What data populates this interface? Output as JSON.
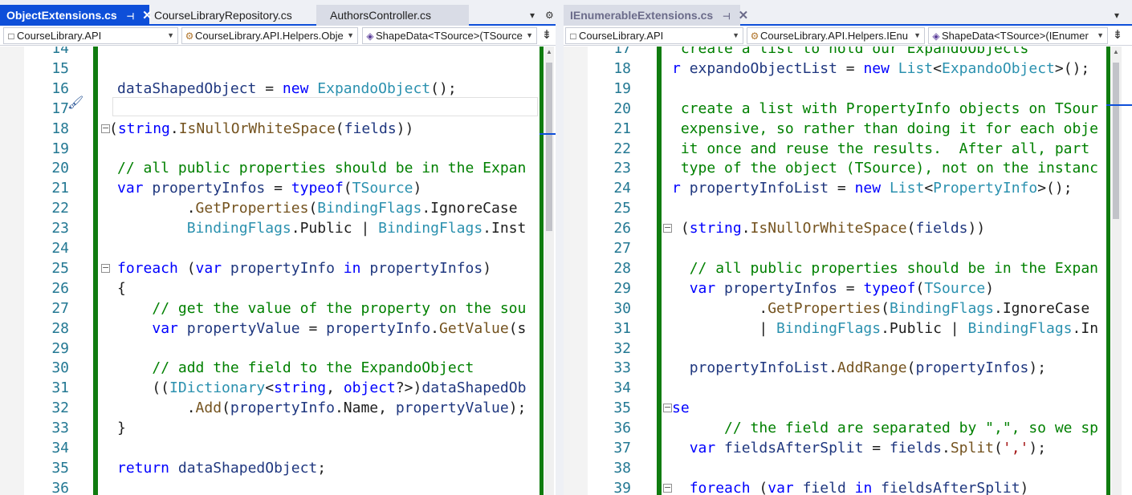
{
  "left_pane": {
    "tabs": [
      {
        "label": "ObjectExtensions.cs",
        "pin_icon": "pin-icon",
        "close_icon": "close-icon"
      },
      {
        "label": "CourseLibraryRepository.cs"
      },
      {
        "label": "AuthorsController.cs"
      }
    ],
    "tab_tools": {
      "dropdown": "▾",
      "settings": "⚙"
    },
    "nav": {
      "project": "CourseLibrary.API",
      "type": "CourseLibrary.API.Helpers.Obje",
      "member": "ShapeData<TSource>(TSource"
    },
    "lines": [
      {
        "n": "14",
        "fold": false,
        "segs": [
          {
            "c": "",
            "t": ""
          }
        ]
      },
      {
        "n": "15",
        "fold": false,
        "segs": [
          {
            "c": "",
            "t": ""
          }
        ]
      },
      {
        "n": "16",
        "fold": false,
        "segs": [
          {
            "c": "id",
            "t": "dataShapedObject"
          },
          {
            "c": "",
            "t": " = "
          },
          {
            "c": "kw",
            "t": "new"
          },
          {
            "c": "",
            "t": " "
          },
          {
            "c": "ty",
            "t": "ExpandoObject"
          },
          {
            "c": "",
            "t": "();"
          }
        ]
      },
      {
        "n": "17",
        "fold": false,
        "segs": [
          {
            "c": "",
            "t": ""
          }
        ]
      },
      {
        "n": "18",
        "fold": true,
        "segs": [
          {
            "c": "",
            "t": "("
          },
          {
            "c": "kw",
            "t": "string"
          },
          {
            "c": "",
            "t": "."
          },
          {
            "c": "mt",
            "t": "IsNullOrWhiteSpace"
          },
          {
            "c": "",
            "t": "("
          },
          {
            "c": "id",
            "t": "fields"
          },
          {
            "c": "",
            "t": "))"
          }
        ]
      },
      {
        "n": "19",
        "fold": false,
        "segs": [
          {
            "c": "",
            "t": ""
          }
        ]
      },
      {
        "n": "20",
        "fold": false,
        "segs": [
          {
            "c": "cm",
            "t": "// all public properties should be in the Expan"
          }
        ]
      },
      {
        "n": "21",
        "fold": false,
        "segs": [
          {
            "c": "kw",
            "t": "var"
          },
          {
            "c": "",
            "t": " "
          },
          {
            "c": "id",
            "t": "propertyInfos"
          },
          {
            "c": "",
            "t": " = "
          },
          {
            "c": "kw",
            "t": "typeof"
          },
          {
            "c": "",
            "t": "("
          },
          {
            "c": "ty",
            "t": "TSource"
          },
          {
            "c": "",
            "t": ")"
          }
        ]
      },
      {
        "n": "22",
        "fold": false,
        "segs": [
          {
            "c": "",
            "t": "        ."
          },
          {
            "c": "mt",
            "t": "GetProperties"
          },
          {
            "c": "",
            "t": "("
          },
          {
            "c": "ty",
            "t": "BindingFlags"
          },
          {
            "c": "",
            "t": ".IgnoreCase"
          }
        ]
      },
      {
        "n": "23",
        "fold": false,
        "segs": [
          {
            "c": "",
            "t": "        "
          },
          {
            "c": "ty",
            "t": "BindingFlags"
          },
          {
            "c": "",
            "t": ".Public | "
          },
          {
            "c": "ty",
            "t": "BindingFlags"
          },
          {
            "c": "",
            "t": ".Inst"
          }
        ]
      },
      {
        "n": "24",
        "fold": false,
        "segs": [
          {
            "c": "",
            "t": ""
          }
        ]
      },
      {
        "n": "25",
        "fold": true,
        "segs": [
          {
            "c": "kw",
            "t": "foreach"
          },
          {
            "c": "",
            "t": " ("
          },
          {
            "c": "kw",
            "t": "var"
          },
          {
            "c": "",
            "t": " "
          },
          {
            "c": "id",
            "t": "propertyInfo"
          },
          {
            "c": "",
            "t": " "
          },
          {
            "c": "kw",
            "t": "in"
          },
          {
            "c": "",
            "t": " "
          },
          {
            "c": "id",
            "t": "propertyInfos"
          },
          {
            "c": "",
            "t": ")"
          }
        ]
      },
      {
        "n": "26",
        "fold": false,
        "segs": [
          {
            "c": "",
            "t": "{"
          }
        ]
      },
      {
        "n": "27",
        "fold": false,
        "segs": [
          {
            "c": "",
            "t": "    "
          },
          {
            "c": "cm",
            "t": "// get the value of the property on the sou"
          }
        ]
      },
      {
        "n": "28",
        "fold": false,
        "segs": [
          {
            "c": "",
            "t": "    "
          },
          {
            "c": "kw",
            "t": "var"
          },
          {
            "c": "",
            "t": " "
          },
          {
            "c": "id",
            "t": "propertyValue"
          },
          {
            "c": "",
            "t": " = "
          },
          {
            "c": "id",
            "t": "propertyInfo"
          },
          {
            "c": "",
            "t": "."
          },
          {
            "c": "mt",
            "t": "GetValue"
          },
          {
            "c": "",
            "t": "(s"
          }
        ]
      },
      {
        "n": "29",
        "fold": false,
        "segs": [
          {
            "c": "",
            "t": ""
          }
        ]
      },
      {
        "n": "30",
        "fold": false,
        "segs": [
          {
            "c": "",
            "t": "    "
          },
          {
            "c": "cm",
            "t": "// add the field to the ExpandoObject"
          }
        ]
      },
      {
        "n": "31",
        "fold": false,
        "segs": [
          {
            "c": "",
            "t": "    (("
          },
          {
            "c": "ty",
            "t": "IDictionary"
          },
          {
            "c": "",
            "t": "<"
          },
          {
            "c": "kw",
            "t": "string"
          },
          {
            "c": "",
            "t": ", "
          },
          {
            "c": "kw",
            "t": "object"
          },
          {
            "c": "",
            "t": "?>)"
          },
          {
            "c": "id",
            "t": "dataShapedOb"
          }
        ]
      },
      {
        "n": "32",
        "fold": false,
        "segs": [
          {
            "c": "",
            "t": "        ."
          },
          {
            "c": "mt",
            "t": "Add"
          },
          {
            "c": "",
            "t": "("
          },
          {
            "c": "id",
            "t": "propertyInfo"
          },
          {
            "c": "",
            "t": ".Name, "
          },
          {
            "c": "id",
            "t": "propertyValue"
          },
          {
            "c": "",
            "t": ");"
          }
        ]
      },
      {
        "n": "33",
        "fold": false,
        "segs": [
          {
            "c": "",
            "t": "}"
          }
        ]
      },
      {
        "n": "34",
        "fold": false,
        "segs": [
          {
            "c": "",
            "t": ""
          }
        ]
      },
      {
        "n": "35",
        "fold": false,
        "segs": [
          {
            "c": "kw",
            "t": "return"
          },
          {
            "c": "",
            "t": " "
          },
          {
            "c": "id",
            "t": "dataShapedObject"
          },
          {
            "c": "",
            "t": ";"
          }
        ]
      },
      {
        "n": "36",
        "fold": false,
        "segs": [
          {
            "c": "",
            "t": ""
          }
        ]
      }
    ]
  },
  "right_pane": {
    "tabs": [
      {
        "label": "IEnumerableExtensions.cs",
        "pin_icon": "pin-icon",
        "close_icon": "close-icon"
      }
    ],
    "tab_tools": {
      "dropdown": "▾"
    },
    "nav": {
      "project": "CourseLibrary.API",
      "type": "CourseLibrary.API.Helpers.IEnu",
      "member": "ShapeData<TSource>(IEnumer"
    },
    "lines": [
      {
        "n": "17",
        "fold": false,
        "segs": [
          {
            "c": "cm",
            "t": " create a list to hold our ExpandoObjects"
          }
        ]
      },
      {
        "n": "18",
        "fold": false,
        "segs": [
          {
            "c": "kw",
            "t": "r"
          },
          {
            "c": "",
            "t": " "
          },
          {
            "c": "id",
            "t": "expandoObjectList"
          },
          {
            "c": "",
            "t": " = "
          },
          {
            "c": "kw",
            "t": "new"
          },
          {
            "c": "",
            "t": " "
          },
          {
            "c": "ty",
            "t": "List"
          },
          {
            "c": "",
            "t": "<"
          },
          {
            "c": "ty",
            "t": "ExpandoObject"
          },
          {
            "c": "",
            "t": ">();"
          }
        ]
      },
      {
        "n": "19",
        "fold": false,
        "segs": [
          {
            "c": "",
            "t": ""
          }
        ]
      },
      {
        "n": "20",
        "fold": false,
        "segs": [
          {
            "c": "cm",
            "t": " create a list with PropertyInfo objects on TSour"
          }
        ]
      },
      {
        "n": "21",
        "fold": false,
        "segs": [
          {
            "c": "cm",
            "t": " expensive, so rather than doing it for each obje"
          }
        ]
      },
      {
        "n": "22",
        "fold": false,
        "segs": [
          {
            "c": "cm",
            "t": " it once and reuse the results.  After all, part"
          }
        ]
      },
      {
        "n": "23",
        "fold": false,
        "segs": [
          {
            "c": "cm",
            "t": " type of the object (TSource), not on the instanc"
          }
        ]
      },
      {
        "n": "24",
        "fold": false,
        "segs": [
          {
            "c": "kw",
            "t": "r"
          },
          {
            "c": "",
            "t": " "
          },
          {
            "c": "id",
            "t": "propertyInfoList"
          },
          {
            "c": "",
            "t": " = "
          },
          {
            "c": "kw",
            "t": "new"
          },
          {
            "c": "",
            "t": " "
          },
          {
            "c": "ty",
            "t": "List"
          },
          {
            "c": "",
            "t": "<"
          },
          {
            "c": "ty",
            "t": "PropertyInfo"
          },
          {
            "c": "",
            "t": ">();"
          }
        ]
      },
      {
        "n": "25",
        "fold": false,
        "segs": [
          {
            "c": "",
            "t": ""
          }
        ]
      },
      {
        "n": "26",
        "fold": true,
        "segs": [
          {
            "c": "",
            "t": " ("
          },
          {
            "c": "kw",
            "t": "string"
          },
          {
            "c": "",
            "t": "."
          },
          {
            "c": "mt",
            "t": "IsNullOrWhiteSpace"
          },
          {
            "c": "",
            "t": "("
          },
          {
            "c": "id",
            "t": "fields"
          },
          {
            "c": "",
            "t": "))"
          }
        ]
      },
      {
        "n": "27",
        "fold": false,
        "segs": [
          {
            "c": "",
            "t": ""
          }
        ]
      },
      {
        "n": "28",
        "fold": false,
        "segs": [
          {
            "c": "",
            "t": "  "
          },
          {
            "c": "cm",
            "t": "// all public properties should be in the Expan"
          }
        ]
      },
      {
        "n": "29",
        "fold": false,
        "segs": [
          {
            "c": "",
            "t": "  "
          },
          {
            "c": "kw",
            "t": "var"
          },
          {
            "c": "",
            "t": " "
          },
          {
            "c": "id",
            "t": "propertyInfos"
          },
          {
            "c": "",
            "t": " = "
          },
          {
            "c": "kw",
            "t": "typeof"
          },
          {
            "c": "",
            "t": "("
          },
          {
            "c": "ty",
            "t": "TSource"
          },
          {
            "c": "",
            "t": ")"
          }
        ]
      },
      {
        "n": "30",
        "fold": false,
        "segs": [
          {
            "c": "",
            "t": "          ."
          },
          {
            "c": "mt",
            "t": "GetProperties"
          },
          {
            "c": "",
            "t": "("
          },
          {
            "c": "ty",
            "t": "BindingFlags"
          },
          {
            "c": "",
            "t": ".IgnoreCase"
          }
        ]
      },
      {
        "n": "31",
        "fold": false,
        "segs": [
          {
            "c": "",
            "t": "          | "
          },
          {
            "c": "ty",
            "t": "BindingFlags"
          },
          {
            "c": "",
            "t": ".Public | "
          },
          {
            "c": "ty",
            "t": "BindingFlags"
          },
          {
            "c": "",
            "t": ".In"
          }
        ]
      },
      {
        "n": "32",
        "fold": false,
        "segs": [
          {
            "c": "",
            "t": ""
          }
        ]
      },
      {
        "n": "33",
        "fold": false,
        "segs": [
          {
            "c": "",
            "t": "  "
          },
          {
            "c": "id",
            "t": "propertyInfoList"
          },
          {
            "c": "",
            "t": "."
          },
          {
            "c": "mt",
            "t": "AddRange"
          },
          {
            "c": "",
            "t": "("
          },
          {
            "c": "id",
            "t": "propertyInfos"
          },
          {
            "c": "",
            "t": ");"
          }
        ]
      },
      {
        "n": "34",
        "fold": false,
        "segs": [
          {
            "c": "",
            "t": ""
          }
        ]
      },
      {
        "n": "35",
        "fold": true,
        "segs": [
          {
            "c": "kw",
            "t": "se"
          }
        ]
      },
      {
        "n": "36",
        "fold": false,
        "segs": [
          {
            "c": "",
            "t": "      "
          },
          {
            "c": "cm",
            "t": "// the field are separated by \",\", so we sp"
          }
        ]
      },
      {
        "n": "37",
        "fold": false,
        "segs": [
          {
            "c": "",
            "t": "  "
          },
          {
            "c": "kw",
            "t": "var"
          },
          {
            "c": "",
            "t": " "
          },
          {
            "c": "id",
            "t": "fieldsAfterSplit"
          },
          {
            "c": "",
            "t": " = "
          },
          {
            "c": "id",
            "t": "fields"
          },
          {
            "c": "",
            "t": "."
          },
          {
            "c": "mt",
            "t": "Split"
          },
          {
            "c": "",
            "t": "("
          },
          {
            "c": "st",
            "t": "','"
          },
          {
            "c": "",
            "t": ");"
          }
        ]
      },
      {
        "n": "38",
        "fold": false,
        "segs": [
          {
            "c": "",
            "t": ""
          }
        ]
      },
      {
        "n": "39",
        "fold": true,
        "segs": [
          {
            "c": "",
            "t": "  "
          },
          {
            "c": "kw",
            "t": "foreach"
          },
          {
            "c": "",
            "t": " ("
          },
          {
            "c": "kw",
            "t": "var"
          },
          {
            "c": "",
            "t": " "
          },
          {
            "c": "id",
            "t": "field"
          },
          {
            "c": "",
            "t": " "
          },
          {
            "c": "kw",
            "t": "in"
          },
          {
            "c": "",
            "t": " "
          },
          {
            "c": "id",
            "t": "fieldsAfterSplit"
          },
          {
            "c": "",
            "t": ")"
          }
        ]
      }
    ]
  },
  "colors": {
    "accent": "#0e4fd9",
    "change_bar": "#107c10",
    "keyword": "#0000ff",
    "type": "#2b91af",
    "comment": "#008000",
    "line_number": "#237893"
  }
}
